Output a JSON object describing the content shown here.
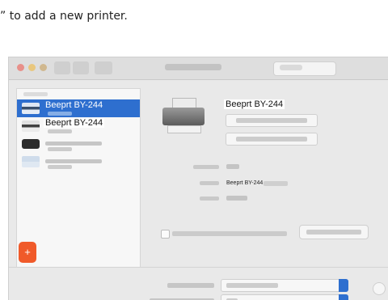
{
  "caption": "” to add a new printer.",
  "printers": [
    {
      "name": "Beeprt BY-244",
      "selected": true
    },
    {
      "name": "Beeprt BY-244",
      "selected": false
    },
    {
      "name": "",
      "selected": false
    },
    {
      "name": "",
      "selected": false
    }
  ],
  "detail": {
    "printer_name": "Beeprt BY-244",
    "location_value": "Beeprt BY-244"
  },
  "add_button": "+",
  "colors": {
    "selection": "#2e6fcf",
    "highlight": "#f05a2a"
  }
}
